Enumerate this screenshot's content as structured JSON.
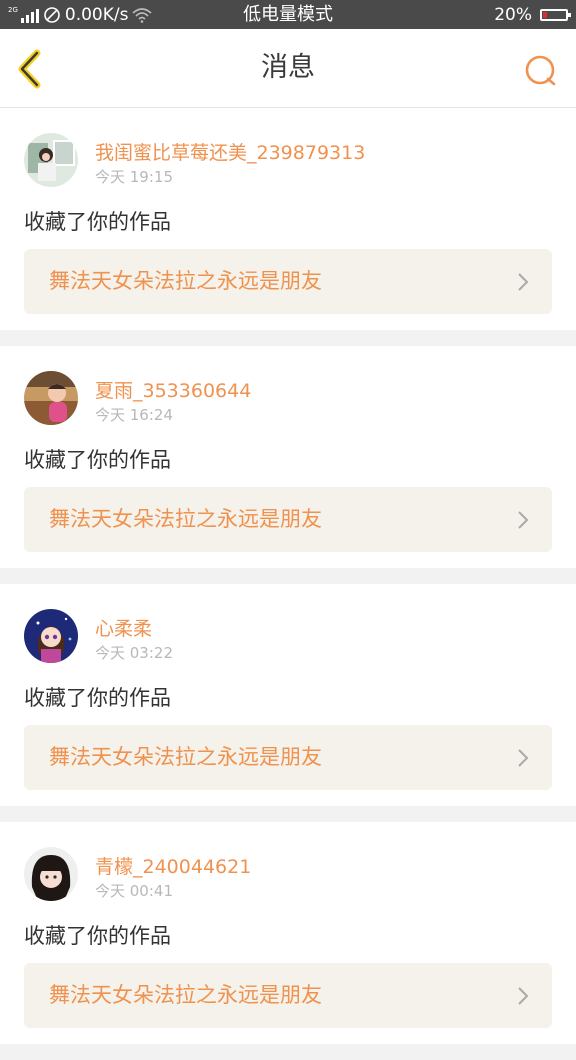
{
  "status_bar": {
    "network_tag": "2G",
    "speed": "0.00K/s",
    "mode": "低电量模式",
    "battery_text": "20%",
    "battery_level": 0.2,
    "battery_color": "#e02b2b"
  },
  "header": {
    "title": "消息",
    "back_icon": "chevron-left-icon",
    "search_icon": "search-icon",
    "accent_color": "#f0924f"
  },
  "messages": [
    {
      "username": "我闺蜜比草莓还美_239879313",
      "time": "今天 19:15",
      "action": "收藏了你的作品",
      "work_title": "舞法天女朵法拉之永远是朋友"
    },
    {
      "username": "夏雨_353360644",
      "time": "今天 16:24",
      "action": "收藏了你的作品",
      "work_title": "舞法天女朵法拉之永远是朋友"
    },
    {
      "username": "心柔柔",
      "time": "今天 03:22",
      "action": "收藏了你的作品",
      "work_title": "舞法天女朵法拉之永远是朋友"
    },
    {
      "username": "青檬_240044621",
      "time": "今天 00:41",
      "action": "收藏了你的作品",
      "work_title": "舞法天女朵法拉之永远是朋友"
    }
  ]
}
